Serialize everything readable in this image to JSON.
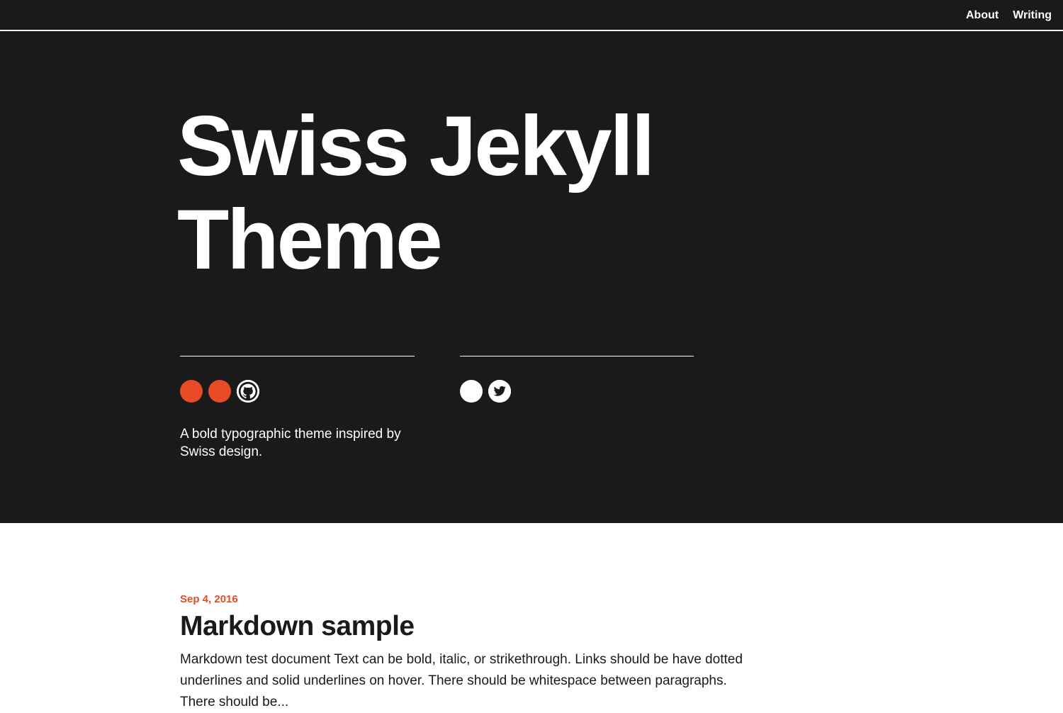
{
  "nav": {
    "items": [
      {
        "label": "About"
      },
      {
        "label": "Writing"
      }
    ]
  },
  "hero": {
    "title_line1": "Swiss Jekyll",
    "title_line2": "Theme",
    "tagline": "A bold typographic theme inspired by Swiss design.",
    "left_icons": [
      "accent-dot-icon",
      "accent-dot-icon",
      "github-icon"
    ],
    "right_icons": [
      "white-dot-icon",
      "twitter-icon"
    ]
  },
  "posts": [
    {
      "date": "Sep 4, 2016",
      "title": "Markdown sample",
      "excerpt": "Markdown test document Text can be bold, italic, or strikethrough. Links should be have dotted underlines and solid underlines on hover. There should be whitespace between paragraphs. There should be..."
    }
  ],
  "colors": {
    "background_dark": "#1a1a1a",
    "accent": "#e84a27",
    "text_light": "#ffffff",
    "text_dark": "#1a1a1a"
  }
}
